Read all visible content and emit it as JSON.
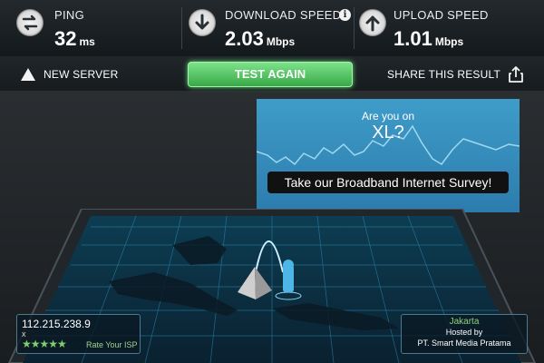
{
  "stats": {
    "ping": {
      "label": "PING",
      "value": "32",
      "unit": "ms",
      "icon": "ping-exchange-icon"
    },
    "download": {
      "label": "DOWNLOAD SPEED",
      "value": "2.03",
      "unit": "Mbps",
      "icon": "download-arrow-icon",
      "info_icon": "info-icon",
      "info_glyph": "i"
    },
    "upload": {
      "label": "UPLOAD SPEED",
      "value": "1.01",
      "unit": "Mbps",
      "icon": "upload-arrow-icon"
    }
  },
  "actions": {
    "new_server": "NEW SERVER",
    "test_again": "TEST AGAIN",
    "share": "SHARE THIS RESULT"
  },
  "survey": {
    "line1": "Are you on",
    "line2": "XL?",
    "button": "Take our Broadband Internet Survey!"
  },
  "footer": {
    "ip": "112.215.238.9",
    "ip_suffix": "x",
    "stars": "★★★★★",
    "rate_isp": "Rate Your ISP",
    "city": "Jakarta",
    "hosted_by": "Hosted by",
    "host_name": "PT. Smart Media Pratama"
  },
  "colors": {
    "accent_green": "#38a947",
    "survey_blue": "#2c7cae",
    "grid_blue": "#3ab4e6"
  }
}
